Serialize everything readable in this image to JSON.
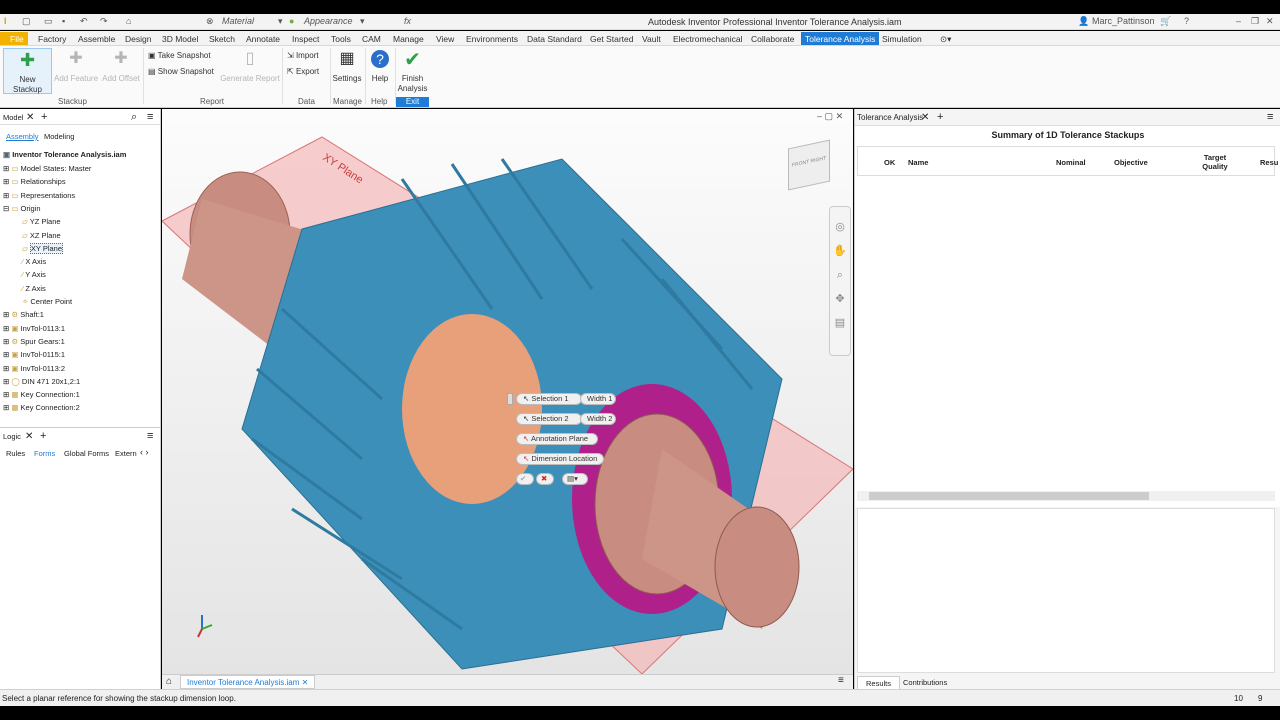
{
  "window": {
    "title": "Autodesk Inventor Professional   Inventor Tolerance Analysis.iam",
    "user": "Marc_Pattinson",
    "material": "Material",
    "appearance": "Appearance"
  },
  "tabs": [
    "File",
    "Factory",
    "Assemble",
    "Design",
    "3D Model",
    "Sketch",
    "Annotate",
    "Inspect",
    "Tools",
    "CAM",
    "Manage",
    "View",
    "Environments",
    "Data Standard",
    "Get Started",
    "Vault",
    "Electromechanical",
    "Collaborate",
    "Tolerance Analysis",
    "Simulation"
  ],
  "ribbon": {
    "new_stackup": "New Stackup",
    "add_feature": "Add Feature",
    "add_offset": "Add Offset",
    "take_snapshot": "Take Snapshot",
    "show_snapshot": "Show Snapshot",
    "generate_report": "Generate Report",
    "import": "Import",
    "export": "Export",
    "settings": "Settings",
    "help": "Help",
    "finish_analysis": "Finish Analysis",
    "groups": {
      "stackup": "Stackup",
      "report": "Report",
      "data": "Data",
      "manage": "Manage",
      "help": "Help",
      "exit": "Exit"
    }
  },
  "browser": {
    "title": "Model",
    "tab_assembly": "Assembly",
    "tab_modeling": "Modeling",
    "root": "Inventor Tolerance Analysis.iam",
    "items": [
      "Model States: Master",
      "Relationships",
      "Representations",
      "Origin",
      "YZ Plane",
      "XZ Plane",
      "XY Plane",
      "X Axis",
      "Y Axis",
      "Z Axis",
      "Center Point",
      "Shaft:1",
      "InvTol-0113:1",
      "Spur Gears:1",
      "InvTol-0115:1",
      "InvTol-0113:2",
      "DIN 471 20x1,2:1",
      "Key Connection:1",
      "Key Connection:2"
    ]
  },
  "logic": {
    "title": "Logic",
    "tabs": [
      "Rules",
      "Forms",
      "Global Forms",
      "Extern"
    ]
  },
  "viewport": {
    "plane_label": "XY Plane",
    "doc_tab": "Inventor Tolerance Analysis.iam",
    "mini": {
      "selection1": "Selection 1",
      "width1": "Width 1",
      "selection2": "Selection 2",
      "width2": "Width 2",
      "annotation_plane": "Annotation Plane",
      "dimension_location": "Dimension Location"
    },
    "viewcube": {
      "front": "FRONT",
      "right": "RIGHT"
    }
  },
  "tolerance": {
    "panel_title": "Tolerance Analysis",
    "summary": "Summary of 1D Tolerance Stackups",
    "columns": [
      "OK",
      "Name",
      "Nominal",
      "Objective",
      "Target Quality",
      "Resu"
    ],
    "bottom_tabs": [
      "Results",
      "Contributions"
    ]
  },
  "status": {
    "message": "Select a planar reference for showing the stackup dimension loop.",
    "n1": "10",
    "n2": "9"
  },
  "colors": {
    "accent": "#1e7bd6",
    "file_tab": "#f2b300",
    "gear": "#3c8fb8",
    "shaft": "#c98c80",
    "plane": "#f5b8b8",
    "ring": "#b0208a"
  }
}
